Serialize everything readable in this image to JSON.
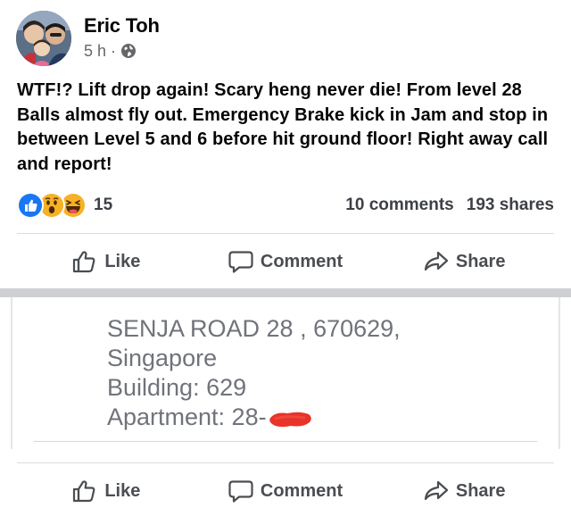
{
  "post": {
    "author": "Eric Toh",
    "time": "5 h",
    "separator": "·",
    "privacy_icon": "globe-icon",
    "text": "WTF!? Lift drop again! Scary heng never die! From level 28 Balls almost fly out. Emergency Brake kick in Jam and stop in between Level 5 and 6 before hit ground floor! Right away call and report!"
  },
  "reactions": {
    "icons": [
      "like-reaction-icon",
      "wow-reaction-icon",
      "haha-reaction-icon"
    ],
    "count": "15",
    "comments": "10 comments",
    "shares": "193 shares"
  },
  "actions": {
    "like": "Like",
    "comment": "Comment",
    "share": "Share"
  },
  "shared_image": {
    "line1": "SENJA ROAD 28 , 670629,",
    "line2": "Singapore",
    "line3": "Building: 629",
    "line4_prefix": "Apartment: 28-"
  },
  "colors": {
    "text": "#050505",
    "muted": "#65676b",
    "like_blue": "#1877f2",
    "reaction_yellow": "#f7b125",
    "redaction_red": "#e8342a"
  }
}
